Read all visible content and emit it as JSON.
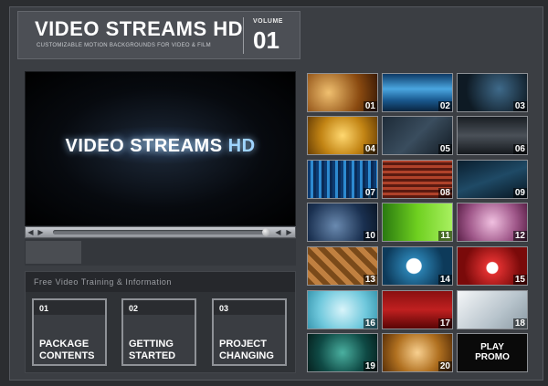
{
  "header": {
    "title_main": "VIDEO STREAMS",
    "title_hd": "HD",
    "subtitle": "CUSTOMIZABLE MOTION BACKGROUNDS FOR VIDEO & FILM",
    "volume_label": "VOLUME",
    "volume_number": "01"
  },
  "player": {
    "title_main": "VIDEO STREAMS",
    "title_hd": "HD"
  },
  "training": {
    "title": "Free Video Training & Information",
    "items": [
      {
        "num": "01",
        "label": "PACKAGE\nCONTENTS"
      },
      {
        "num": "02",
        "label": "GETTING\nSTARTED"
      },
      {
        "num": "03",
        "label": "PROJECT\nCHANGING"
      }
    ]
  },
  "thumbnails": [
    {
      "num": "01",
      "bg": "radial-gradient(circle at 30% 50%, #f0c070, #8a4a10 60%, #3a1a05)"
    },
    {
      "num": "02",
      "bg": "linear-gradient(#0d3a66, #4aa6e0 40%, #1a5a90 70%, #0a2540)"
    },
    {
      "num": "03",
      "bg": "radial-gradient(circle at 60% 40%, #3f6a8a, #0e1a24 70%)"
    },
    {
      "num": "04",
      "bg": "radial-gradient(circle at 50% 50%, #ffd870, #c28414 55%, #6a4005)"
    },
    {
      "num": "05",
      "bg": "linear-gradient(135deg, #1d2b38, #3a4d5e 50%, #121a22)"
    },
    {
      "num": "06",
      "bg": "linear-gradient(#1a1f24, #4a5058 50%, #15191d)"
    },
    {
      "num": "07",
      "bg": "repeating-linear-gradient(90deg, #0c3a70 0 3px, #2d8ad0 3px 6px, #0a2a55 6px 9px)"
    },
    {
      "num": "08",
      "bg": "repeating-linear-gradient(0deg, #5a1a10 0 3px, #b0422a 3px 6px)"
    },
    {
      "num": "09",
      "bg": "linear-gradient(160deg, #0a1e2e, #1f4a66 50%, #071520)"
    },
    {
      "num": "10",
      "bg": "radial-gradient(circle at 40% 60%, #6a8ab0, #1a3050 60%, #0a1525)"
    },
    {
      "num": "11",
      "bg": "linear-gradient(90deg, #2a7a10, #6fd020 50%, #a8f060)"
    },
    {
      "num": "12",
      "bg": "radial-gradient(circle at 50% 50%, #f0c0e0, #a0588a 60%, #5a2048)"
    },
    {
      "num": "13",
      "bg": "repeating-linear-gradient(45deg, #7a4a1a 0 6px, #c08040 6px 12px)"
    },
    {
      "num": "14",
      "bg": "radial-gradient(circle at 45% 50%, #ffffff 0 8px, #2a80b0 9px, #0d3a5a 70%)"
    },
    {
      "num": "15",
      "bg": "radial-gradient(circle at 50% 55%, #ffffff 0 6px, #e03030 7px, #7a0a0a 70%)"
    },
    {
      "num": "16",
      "bg": "radial-gradient(circle at 50% 50%, #d8f4fa, #6fc8dc 60%, #3a98b0)"
    },
    {
      "num": "17",
      "bg": "linear-gradient(#8a1010, #c02020 50%, #5a0505)"
    },
    {
      "num": "18",
      "bg": "linear-gradient(135deg, #f4f6f8, #b8c4cc 60%, #8a9aa4)"
    },
    {
      "num": "19",
      "bg": "radial-gradient(circle at 50% 50%, #4ab0a0, #0f4a45 60%, #06201e)"
    },
    {
      "num": "20",
      "bg": "radial-gradient(circle at 50% 50%, #f8d090, #b07020 55%, #5a3008)"
    }
  ],
  "promo": {
    "label": "PLAY\nPROMO"
  }
}
